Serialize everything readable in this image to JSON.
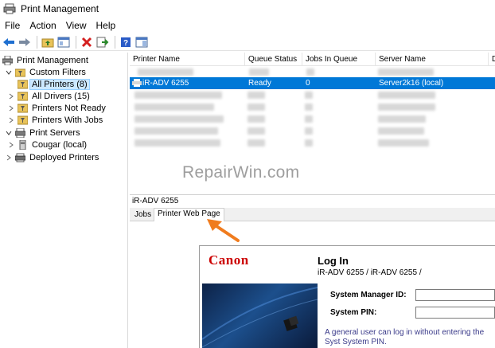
{
  "window": {
    "title": "Print Management"
  },
  "menu": [
    "File",
    "Action",
    "View",
    "Help"
  ],
  "toolbar": {
    "icons": [
      "back-arrow-icon",
      "forward-arrow-icon",
      "up-folder-icon",
      "show-hide-tree-icon",
      "delete-icon",
      "export-icon",
      "help-icon",
      "properties-icon"
    ],
    "colors": {
      "back": "#1e6fd0",
      "delete": "#d42020",
      "help": "#2a5bc7"
    }
  },
  "tree": {
    "items": [
      {
        "label": "Print Management",
        "icon": "print-management-icon",
        "expander": "",
        "level": 0
      },
      {
        "label": "Custom Filters",
        "icon": "filter-folder-icon",
        "expander": "open",
        "level": 1
      },
      {
        "label": "All Printers (8)",
        "icon": "filter-icon",
        "expander": "",
        "level": 2,
        "selected": true
      },
      {
        "label": "All Drivers (15)",
        "icon": "filter-icon",
        "expander": "closed",
        "level": 2
      },
      {
        "label": "Printers Not Ready",
        "icon": "filter-icon",
        "expander": "closed",
        "level": 2
      },
      {
        "label": "Printers With Jobs",
        "icon": "filter-icon",
        "expander": "closed",
        "level": 2
      },
      {
        "label": "Print Servers",
        "icon": "print-server-icon",
        "expander": "open",
        "level": 1
      },
      {
        "label": "Cougar (local)",
        "icon": "computer-icon",
        "expander": "closed",
        "level": 2
      },
      {
        "label": "Deployed Printers",
        "icon": "deployed-printers-icon",
        "expander": "closed",
        "level": 1
      }
    ]
  },
  "list": {
    "columns": [
      "Printer Name",
      "Queue Status",
      "Jobs In Queue",
      "Server Name",
      "D"
    ],
    "selected_row": {
      "name": "iR-ADV 6255",
      "status": "Ready",
      "jobs": "0",
      "server": "Server2k16 (local)"
    }
  },
  "watermark": "RepairWin.com",
  "detail": {
    "title": "iR-ADV 6255",
    "tabs": [
      "Jobs",
      "Printer Web Page"
    ],
    "active_tab": "Printer Web Page"
  },
  "webpage": {
    "brand": "Canon",
    "heading": "Log In",
    "subtitle": "iR-ADV 6255 / iR-ADV 6255 /",
    "system_manager_label": "System Manager ID:",
    "system_pin_label": "System PIN:",
    "note": "A general user can log in without entering the Syst System PIN."
  },
  "accent": {
    "selection": "#0078d7",
    "arrow": "#f07c1e",
    "canon_red": "#cc0000"
  }
}
